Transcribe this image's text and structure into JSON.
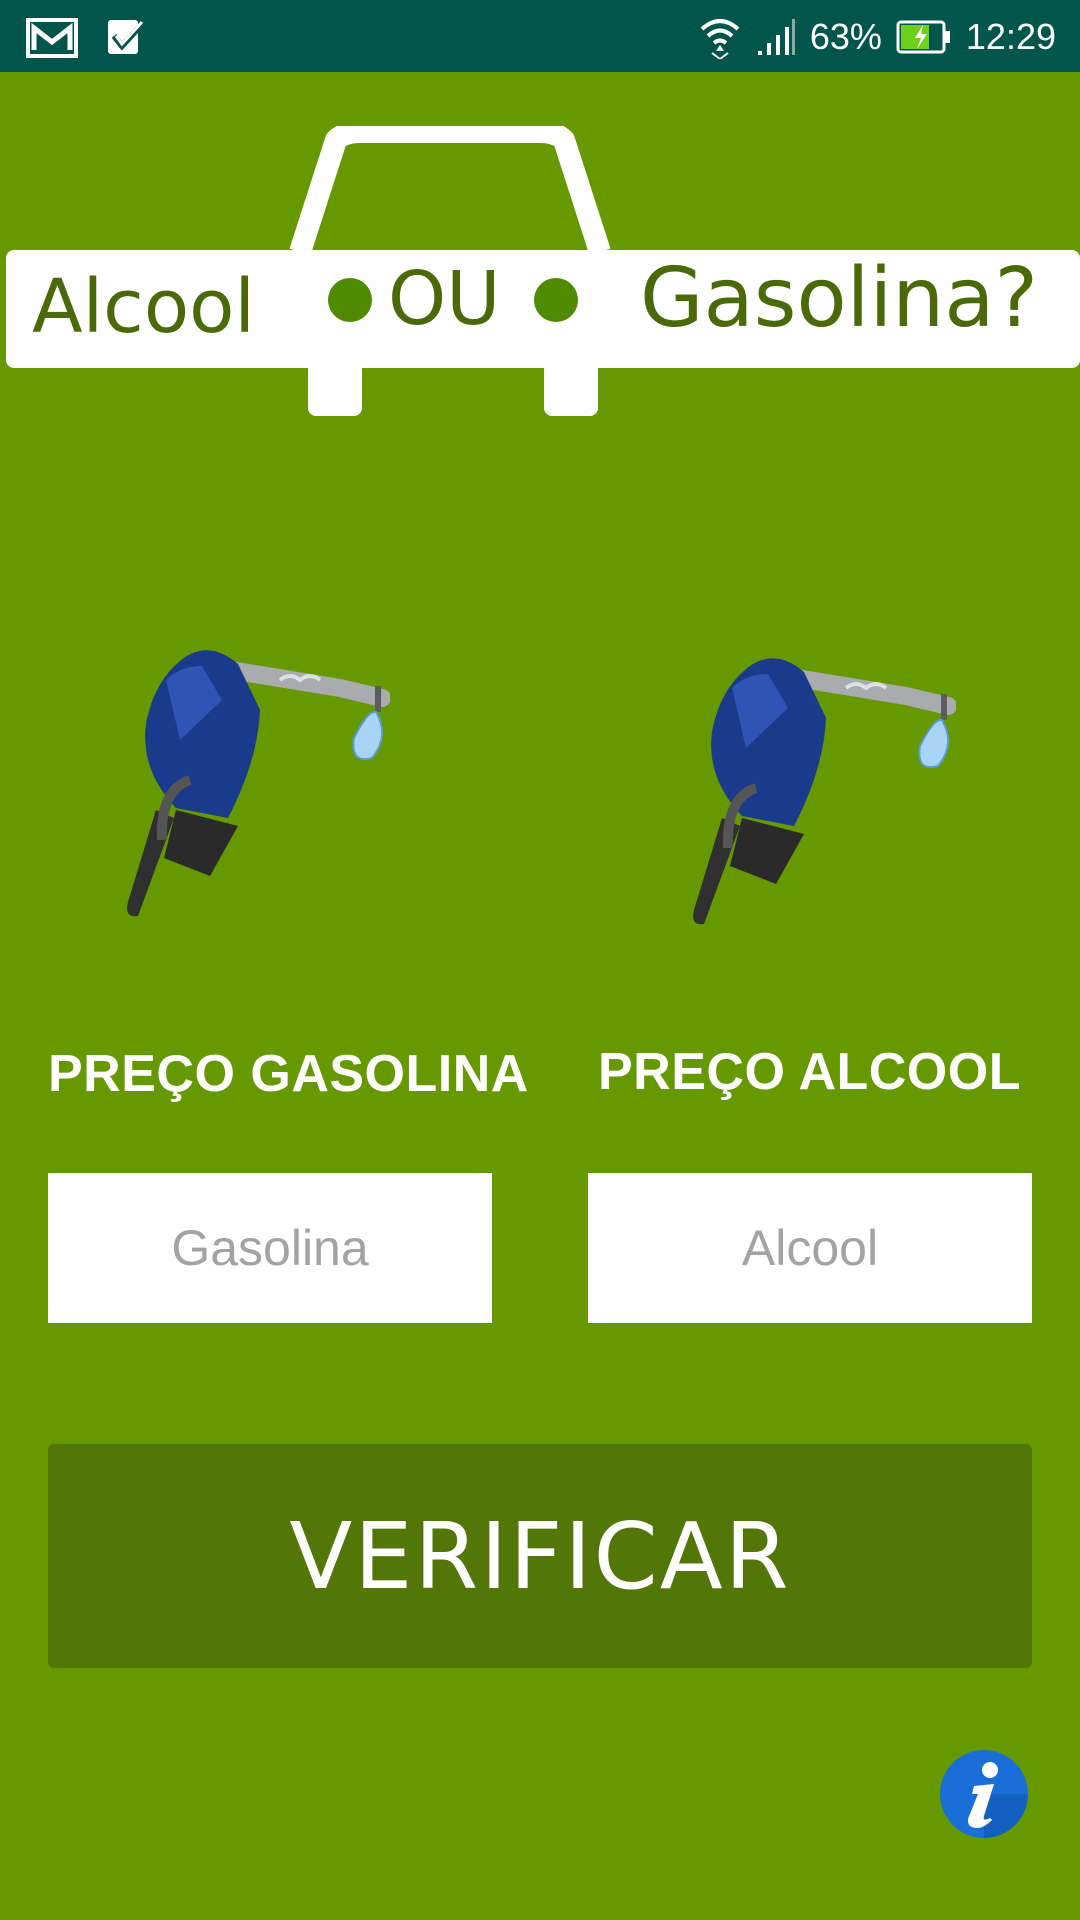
{
  "status_bar": {
    "battery": "63%",
    "time": "12:29",
    "icons": [
      "gmail-icon",
      "tasks-check-icon",
      "wifi-icon",
      "signal-icon",
      "battery-charging-icon"
    ]
  },
  "logo": {
    "left_word": "Alcool",
    "middle_word": "OU",
    "right_word": "Gasolina?"
  },
  "gasoline": {
    "label": "PREÇO GASOLINA",
    "input_value": "",
    "input_placeholder": "Gasolina",
    "icon": "fuel-nozzle-icon"
  },
  "alcohol": {
    "label": "PREÇO ALCOOL",
    "input_value": "",
    "input_placeholder": "Alcool",
    "icon": "fuel-nozzle-icon"
  },
  "verify_button": "VERIFICAR",
  "info_icon": "info-icon",
  "colors": {
    "background": "#669900",
    "status_bar": "#02554a",
    "button": "#527708",
    "logo_text": "#4a6a0a",
    "info_blue": "#1a6ed8"
  }
}
